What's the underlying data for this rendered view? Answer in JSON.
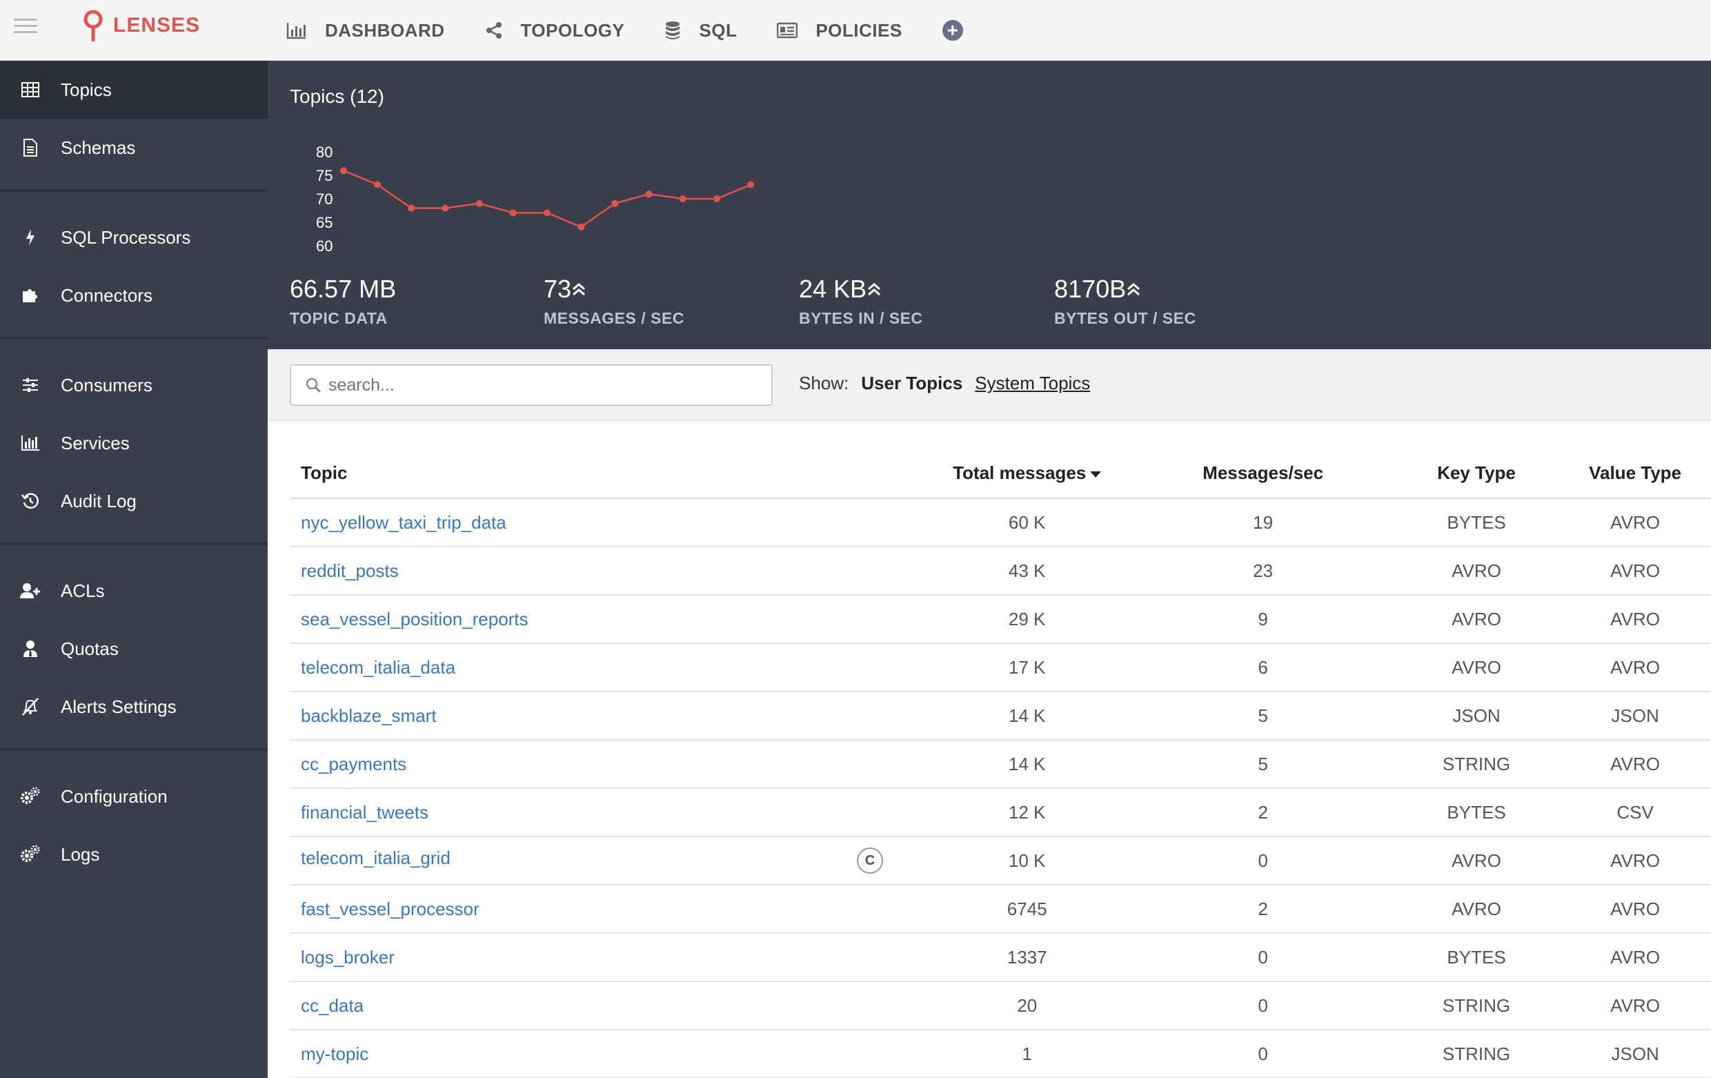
{
  "app": {
    "name": "LENSES"
  },
  "nav": {
    "dashboard": "DASHBOARD",
    "topology": "TOPOLOGY",
    "sql": "SQL",
    "policies": "POLICIES"
  },
  "sidebar": {
    "items": [
      {
        "label": "Topics",
        "icon": "table-icon"
      },
      {
        "label": "Schemas",
        "icon": "document-icon"
      },
      {
        "label": "SQL Processors",
        "icon": "bolt-icon"
      },
      {
        "label": "Connectors",
        "icon": "puzzle-icon"
      },
      {
        "label": "Consumers",
        "icon": "sliders-icon"
      },
      {
        "label": "Services",
        "icon": "bar-chart-icon"
      },
      {
        "label": "Audit Log",
        "icon": "history-icon"
      },
      {
        "label": "ACLs",
        "icon": "user-plus-icon"
      },
      {
        "label": "Quotas",
        "icon": "user-tie-icon"
      },
      {
        "label": "Alerts Settings",
        "icon": "bell-slash-icon"
      },
      {
        "label": "Configuration",
        "icon": "gears-icon"
      },
      {
        "label": "Logs",
        "icon": "gears-icon"
      }
    ]
  },
  "header": {
    "title": "Topics (12)",
    "stats": [
      {
        "value": "66.57 MB",
        "label": "TOPIC DATA",
        "trend": ""
      },
      {
        "value": "73",
        "label": "MESSAGES / SEC",
        "trend": "up"
      },
      {
        "value": "24 KB",
        "label": "BYTES IN / SEC",
        "trend": "up"
      },
      {
        "value": "8170B",
        "label": "BYTES OUT / SEC",
        "trend": "up"
      }
    ]
  },
  "chart_data": {
    "type": "line",
    "x": [
      1,
      2,
      3,
      4,
      5,
      6,
      7,
      8,
      9,
      10,
      11,
      12,
      13
    ],
    "series": [
      {
        "values": [
          76,
          73,
          68,
          68,
          69,
          67,
          67,
          64,
          69,
          71,
          70,
          70,
          73
        ]
      }
    ],
    "yticks": [
      80,
      75,
      70,
      65,
      60
    ],
    "ylim": [
      60,
      80
    ],
    "color": "#e0534f",
    "grid": false
  },
  "filter": {
    "search_placeholder": "search...",
    "show_label": "Show:",
    "user_topics": "User Topics",
    "system_topics": "System Topics"
  },
  "table": {
    "headers": {
      "topic": "Topic",
      "total": "Total messages",
      "rate": "Messages/sec",
      "key": "Key Type",
      "value": "Value Type"
    },
    "rows": [
      {
        "topic": "nyc_yellow_taxi_trip_data",
        "badge": "",
        "total": "60 K",
        "rate": "19",
        "key": "BYTES",
        "value": "AVRO"
      },
      {
        "topic": "reddit_posts",
        "badge": "",
        "total": "43 K",
        "rate": "23",
        "key": "AVRO",
        "value": "AVRO"
      },
      {
        "topic": "sea_vessel_position_reports",
        "badge": "",
        "total": "29 K",
        "rate": "9",
        "key": "AVRO",
        "value": "AVRO"
      },
      {
        "topic": "telecom_italia_data",
        "badge": "",
        "total": "17 K",
        "rate": "6",
        "key": "AVRO",
        "value": "AVRO"
      },
      {
        "topic": "backblaze_smart",
        "badge": "",
        "total": "14 K",
        "rate": "5",
        "key": "JSON",
        "value": "JSON"
      },
      {
        "topic": "cc_payments",
        "badge": "",
        "total": "14 K",
        "rate": "5",
        "key": "STRING",
        "value": "AVRO"
      },
      {
        "topic": "financial_tweets",
        "badge": "",
        "total": "12 K",
        "rate": "2",
        "key": "BYTES",
        "value": "CSV"
      },
      {
        "topic": "telecom_italia_grid",
        "badge": "C",
        "total": "10 K",
        "rate": "0",
        "key": "AVRO",
        "value": "AVRO"
      },
      {
        "topic": "fast_vessel_processor",
        "badge": "",
        "total": "6745",
        "rate": "2",
        "key": "AVRO",
        "value": "AVRO"
      },
      {
        "topic": "logs_broker",
        "badge": "",
        "total": "1337",
        "rate": "0",
        "key": "BYTES",
        "value": "AVRO"
      },
      {
        "topic": "cc_data",
        "badge": "",
        "total": "20",
        "rate": "0",
        "key": "STRING",
        "value": "AVRO"
      },
      {
        "topic": "my-topic",
        "badge": "",
        "total": "1",
        "rate": "0",
        "key": "STRING",
        "value": "JSON"
      }
    ]
  }
}
